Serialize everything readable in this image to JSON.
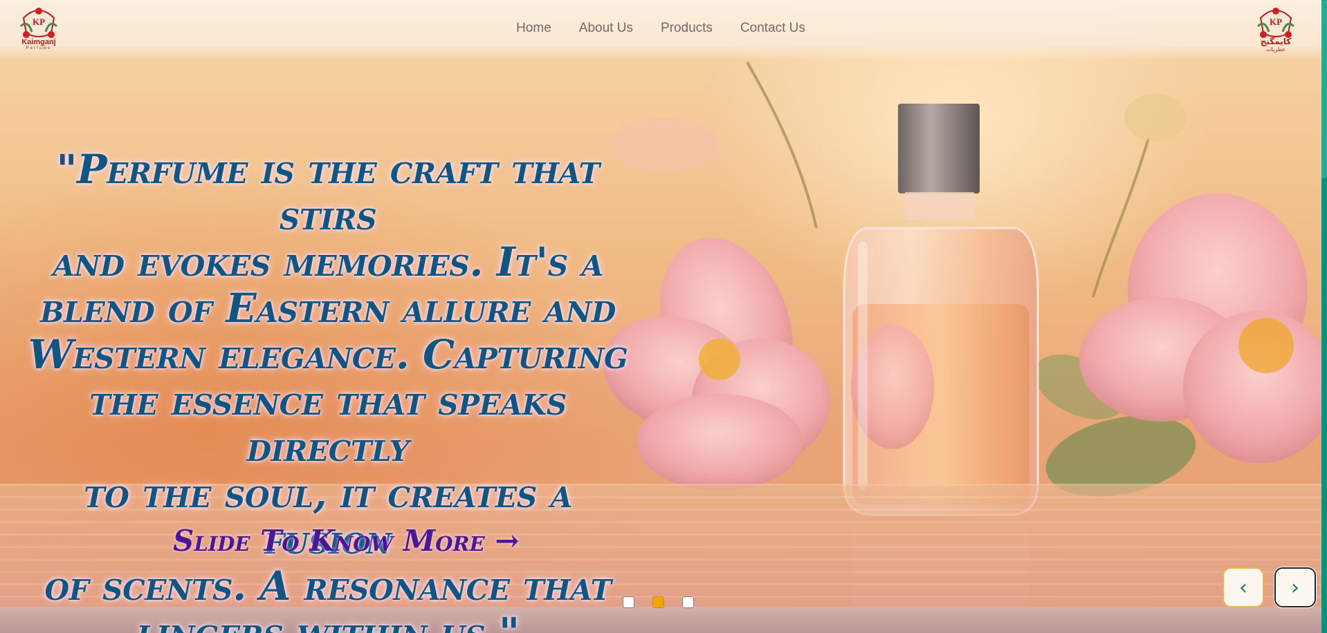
{
  "header": {
    "logo_left_alt": "Kaimganj Perfume logo",
    "logo_left_name": "Kaimganj",
    "logo_left_sub": "Perfume",
    "logo_left_badge": "KP",
    "logo_right_name": "كايمگنج",
    "logo_right_sub": "عطريات",
    "logo_right_badge": "KP",
    "brand_color": "#b01e1e"
  },
  "nav": {
    "items": [
      {
        "label": "Home"
      },
      {
        "label": "About Us"
      },
      {
        "label": "Products"
      },
      {
        "label": "Contact Us"
      }
    ]
  },
  "hero": {
    "quote_lines": [
      "\"Perfume is the craft that stirs",
      "and evokes memories. It's a",
      "blend of Eastern allure and",
      "Western elegance. Capturing",
      "the essence that speaks directly",
      "to the soul, it creates a fusion",
      "of scents. A resonance that",
      "lingers within us.\""
    ],
    "cta_label": "Slide To Know More →",
    "quote_color": "#115683",
    "cta_color": "#4a1796"
  },
  "slider": {
    "active_index": 1,
    "dot_count": 3,
    "prev_icon": "‹",
    "next_icon": "›",
    "accent_color": "#f0a400"
  }
}
